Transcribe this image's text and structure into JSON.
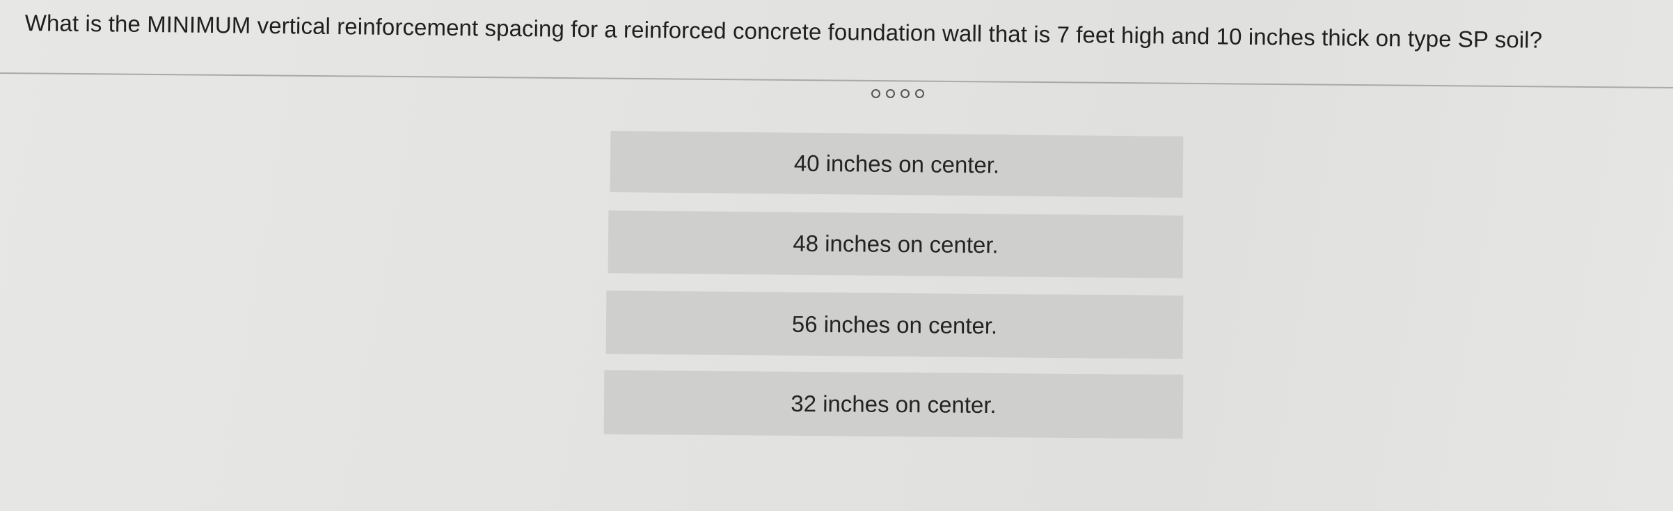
{
  "question": {
    "text": "What is the MINIMUM vertical reinforcement spacing for a reinforced concrete foundation wall that is 7 feet high and 10 inches thick on type SP soil?"
  },
  "progress": {
    "dot_count": 4,
    "icon": "empty-circle-icon"
  },
  "options": [
    {
      "label": "40 inches on center."
    },
    {
      "label": "48 inches on center."
    },
    {
      "label": "56 inches on center."
    },
    {
      "label": "32 inches on center."
    }
  ],
  "colors": {
    "background": "#e4e4e2",
    "option_background": "#cfcfcd",
    "text": "#232323",
    "divider": "#a9a9a7"
  }
}
